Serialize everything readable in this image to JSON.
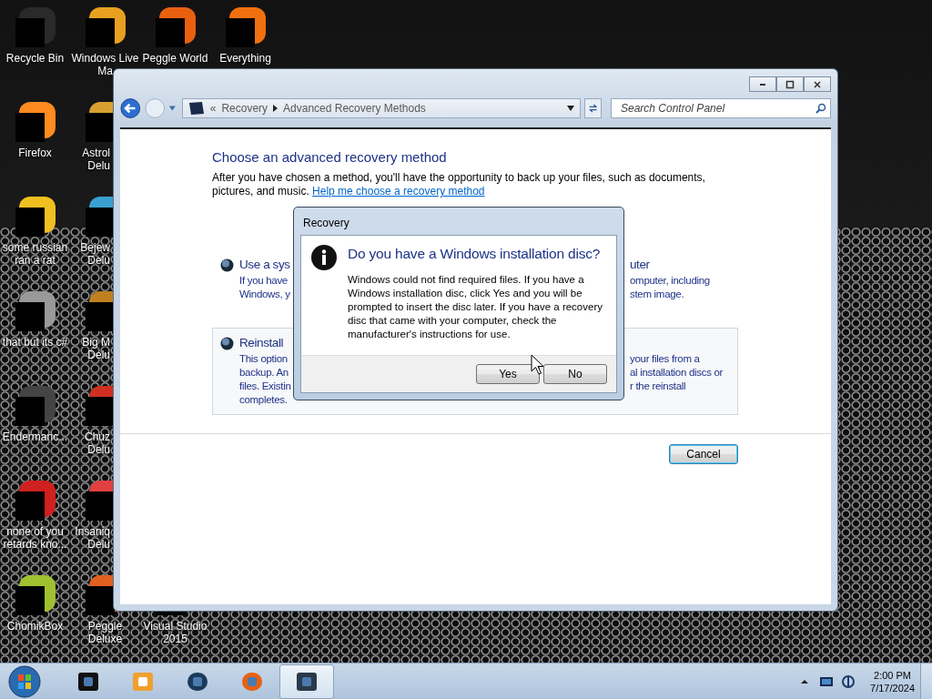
{
  "desktop": {
    "rows": [
      [
        {
          "label": "Recycle Bin"
        },
        {
          "label": "Windows Live Ma"
        },
        {
          "label": "Peggle World"
        },
        {
          "label": "Everything"
        }
      ],
      [
        {
          "label": "Firefox"
        },
        {
          "label": "Astrol Delu"
        }
      ],
      [
        {
          "label": "some russian ran a rat"
        },
        {
          "label": "Bejew Delu"
        }
      ],
      [
        {
          "label": "that but its c#"
        },
        {
          "label": "Big M Delu"
        }
      ],
      [
        {
          "label": "Endermanc..."
        },
        {
          "label": "Chuz Delu"
        }
      ],
      [
        {
          "label": "none of you retards kno..."
        },
        {
          "label": "Insaniq Delu"
        }
      ],
      [
        {
          "label": "ChomikBox"
        },
        {
          "label": "Peggle Deluxe"
        },
        {
          "label": "Visual Studio 2015"
        }
      ]
    ]
  },
  "window": {
    "breadcrumb_prefix": "«",
    "breadcrumb": [
      "Recovery",
      "Advanced Recovery Methods"
    ],
    "search": {
      "placeholder": "Search Control Panel"
    },
    "heading": "Choose an advanced recovery method",
    "intro": {
      "text": "After you have chosen a method, you'll have the opportunity to back up your files, such as documents, pictures, and music.",
      "link": "Help me choose a recovery method"
    },
    "options": [
      {
        "selected": false,
        "title_left": "Use a sys",
        "title_right": "uter",
        "lines_left": [
          "If you have",
          "Windows, y"
        ],
        "lines_right": [
          "omputer, including",
          "stem image."
        ]
      },
      {
        "selected": true,
        "title_left": "Reinstall",
        "lines_left": [
          "This option",
          "backup. An",
          "files. Existin",
          "completes."
        ],
        "lines_right": [
          "your files from a",
          "al installation discs or",
          "r the reinstall"
        ]
      }
    ],
    "cancel": "Cancel"
  },
  "dialog": {
    "title": "Recovery",
    "heading": "Do you have a Windows installation disc?",
    "body": "Windows could not find required files. If you have a Windows installation disc, click Yes and you will be prompted to insert the disc later. If you have a recovery disc that came with your computer, check the manufacturer's instructions for use.",
    "buttons": [
      "Yes",
      "No"
    ]
  },
  "taskbar": {
    "items": [
      {
        "selected": false
      },
      {
        "selected": false
      },
      {
        "selected": false
      },
      {
        "selected": false
      },
      {
        "selected": true
      }
    ],
    "clock": {
      "time": "2:00 PM",
      "date": "7/17/2024"
    }
  }
}
